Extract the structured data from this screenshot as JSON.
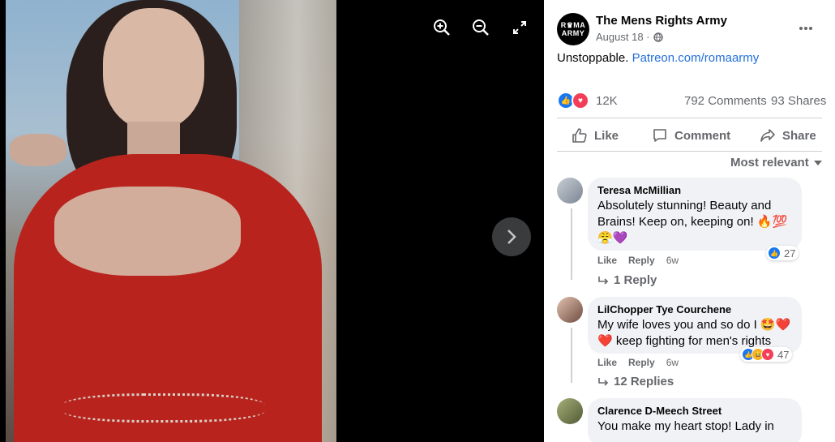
{
  "viewer": {
    "zoom_in_icon": "zoom-in-icon",
    "zoom_out_icon": "zoom-out-icon",
    "fullscreen_icon": "fullscreen-icon",
    "next_icon": "chevron-right-icon"
  },
  "post": {
    "page_avatar_line1": "R♛MA",
    "page_avatar_line2": "ARMY",
    "page_name": "The Mens Rights Army",
    "date": "August 18 ·",
    "caption_text": "Unstoppable. ",
    "caption_link": "Patreon.com/romaarmy",
    "reaction_count": "12K",
    "comments_count": "792 Comments",
    "shares_count": "93 Shares"
  },
  "actions": {
    "like": "Like",
    "comment": "Comment",
    "share": "Share"
  },
  "sort_label": "Most relevant",
  "comments": [
    {
      "name": "Teresa McMillian",
      "text": "Absolutely stunning! Beauty and Brains! Keep on, keeping on! 🔥💯 😤💜",
      "like": "Like",
      "reply": "Reply",
      "time": "6w",
      "reaction_count": "27",
      "replies": "1 Reply"
    },
    {
      "name": "LilChopper Tye Courchene",
      "text": "My wife loves you and so do I 🤩❤️ ❤️ keep fighting for men's rights",
      "like": "Like",
      "reply": "Reply",
      "time": "6w",
      "reaction_count": "47",
      "replies": "12 Replies"
    },
    {
      "name": "Clarence D-Meech Street",
      "text": "You make my heart stop! Lady in"
    }
  ],
  "colors": {
    "link": "#216fdb",
    "like_blue": "#1877f2",
    "love_red": "#f33e58"
  }
}
